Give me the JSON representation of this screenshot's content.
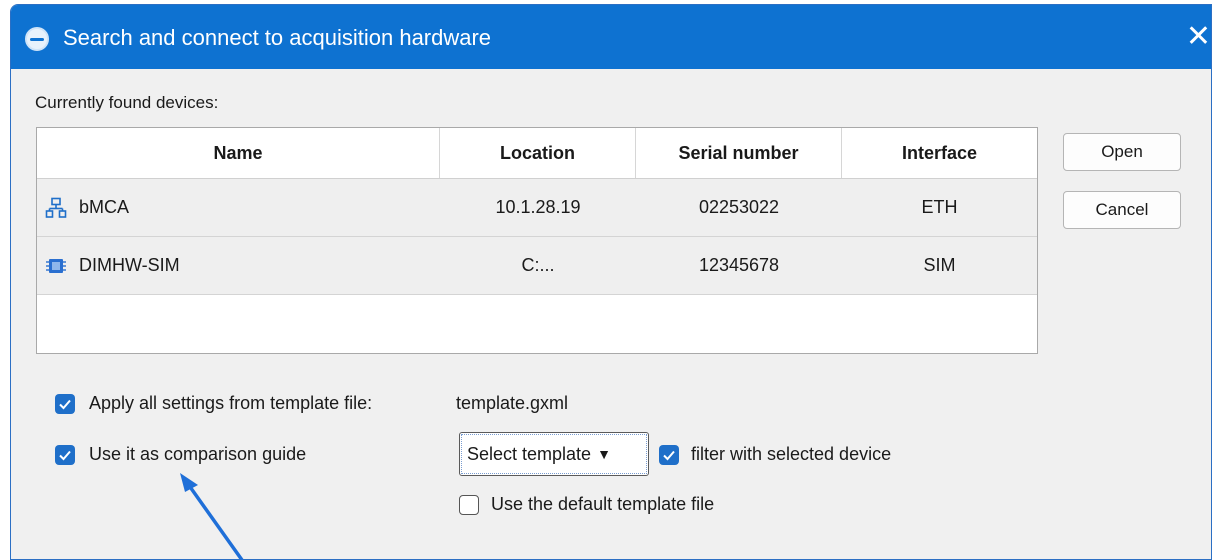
{
  "window": {
    "title": "Search and connect to acquisition hardware",
    "close_glyph": "✕"
  },
  "devices": {
    "label": "Currently found devices:",
    "columns": [
      "Name",
      "Location",
      "Serial number",
      "Interface"
    ],
    "rows": [
      {
        "icon": "network-device-icon",
        "name": "bMCA",
        "location": "10.1.28.19",
        "serial": "02253022",
        "interface": "ETH"
      },
      {
        "icon": "chip-icon",
        "name": "DIMHW-SIM",
        "location": "C:...",
        "serial": "12345678",
        "interface": "SIM"
      }
    ]
  },
  "buttons": {
    "open": "Open",
    "cancel": "Cancel"
  },
  "options": {
    "apply_template_label": "Apply all settings from template file:",
    "apply_template_checked": true,
    "template_filename": "template.gxml",
    "comparison_guide_label": "Use it as comparison guide",
    "comparison_guide_checked": true,
    "select_template_value": "Select template",
    "filter_label": "filter with selected device",
    "filter_checked": true,
    "default_template_label": "Use the default template file",
    "default_template_checked": false
  },
  "colors": {
    "titlebar": "#0e72d1",
    "checkbox_checked": "#1f6fc9",
    "annotation_arrow": "#1f6fd8"
  }
}
